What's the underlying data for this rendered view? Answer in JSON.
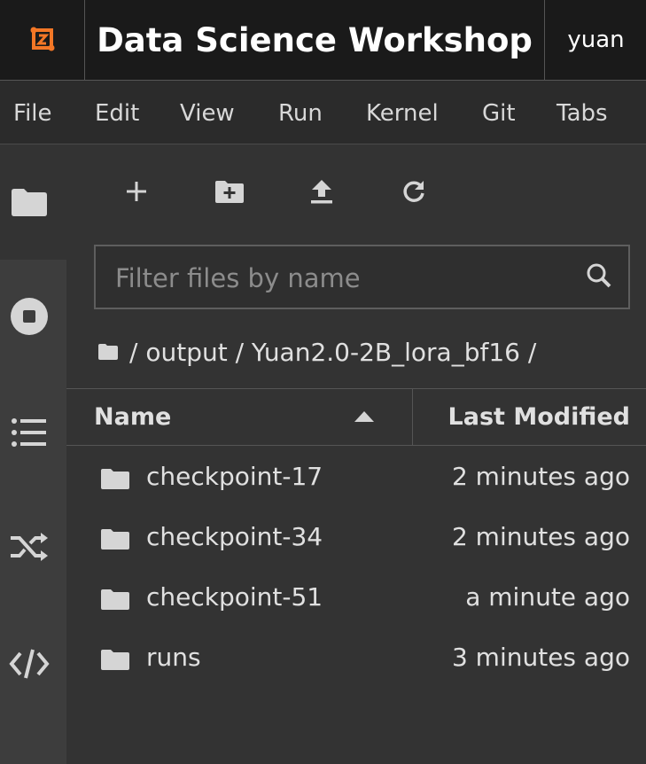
{
  "app": {
    "title": "Data Science Workshop",
    "user": "yuan"
  },
  "menu": {
    "items": [
      "File",
      "Edit",
      "View",
      "Run",
      "Kernel",
      "Git",
      "Tabs"
    ]
  },
  "sidebar": {
    "icons": [
      "folder-icon",
      "stop-circle-icon",
      "list-icon",
      "shuffle-icon",
      "code-icon"
    ],
    "active": "folder-icon"
  },
  "toolbar": {
    "icons": [
      "new-launcher-icon",
      "new-folder-icon",
      "upload-icon",
      "refresh-icon"
    ]
  },
  "filter": {
    "placeholder": "Filter files by name"
  },
  "breadcrumb": {
    "path": "/ output / Yuan2.0-2B_lora_bf16 /"
  },
  "table": {
    "columns": {
      "name": "Name",
      "modified": "Last Modified"
    },
    "sort": "ascending",
    "rows": [
      {
        "name": "checkpoint-17",
        "modified": "2 minutes ago"
      },
      {
        "name": "checkpoint-34",
        "modified": "2 minutes ago"
      },
      {
        "name": "checkpoint-51",
        "modified": "a minute ago"
      },
      {
        "name": "runs",
        "modified": "3 minutes ago"
      }
    ]
  },
  "colors": {
    "accent": "#f37726",
    "background": "#333333",
    "topbar": "#1a1a1a"
  }
}
